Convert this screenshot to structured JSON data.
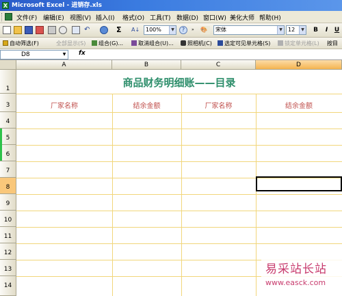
{
  "window": {
    "title": "Microsoft Excel - 进销存.xls"
  },
  "menu": [
    "文件(F)",
    "编辑(E)",
    "视图(V)",
    "插入(I)",
    "格式(O)",
    "工具(T)",
    "数据(D)",
    "窗口(W)",
    "美化大师",
    "帮助(H)"
  ],
  "toolbar": {
    "zoom": "100%",
    "font_name": "宋体",
    "font_size": "12",
    "bold": "B",
    "italic": "I",
    "underline": "U",
    "sigma": "Σ"
  },
  "toolbar2": {
    "autofilter": "自动筛选(F)",
    "show_all": "全部显示(S)",
    "group": "组合(G)...",
    "ungroup": "取消组合(U)...",
    "camera": "照相机(C)",
    "select_visible": "选定可见单元格(S)",
    "lock_cells": "锁定单元格(L)",
    "next": "按目"
  },
  "formula_bar": {
    "name_box": "D8",
    "fx": "fx",
    "content": ""
  },
  "columns": [
    "A",
    "B",
    "C",
    "D"
  ],
  "rows": [
    "1",
    "3",
    "4",
    "5",
    "6",
    "7",
    "8",
    "9",
    "10",
    "11",
    "12",
    "13",
    "14"
  ],
  "sheet": {
    "title": "商品财务明细账——目录",
    "headers": [
      "厂家名称",
      "结余金额",
      "厂家名称",
      "结余金额"
    ]
  },
  "watermark": {
    "title": "易采站长站",
    "url": "www.easck.com"
  },
  "colors": {
    "title_text": "#2f8f6c",
    "header_text": "#c0504d",
    "grid_line": "#f1d67a",
    "selected_header": "#f9c77a"
  }
}
